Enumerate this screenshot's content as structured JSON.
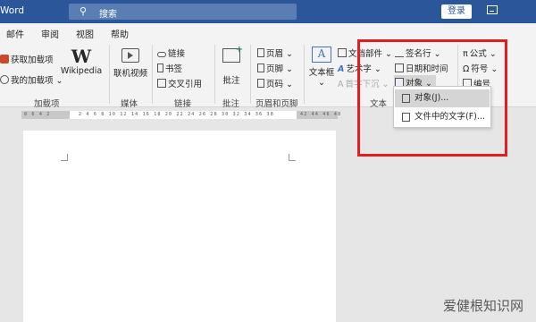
{
  "title_bar": {
    "app_name": "Word",
    "search_placeholder": "搜索",
    "login_label": "登录"
  },
  "tabs": [
    "邮件",
    "审阅",
    "视图",
    "帮助"
  ],
  "ribbon": {
    "addins": {
      "get": "获取加载项",
      "my": "我的加载项",
      "wiki": "Wikipedia",
      "label": "加载项"
    },
    "media": {
      "video": "联机视频",
      "label": "媒体"
    },
    "links": {
      "link": "链接",
      "bookmark": "书签",
      "crossref": "交叉引用",
      "label": "链接"
    },
    "comments": {
      "comment": "批注",
      "label": "批注"
    },
    "header_footer": {
      "header": "页眉",
      "footer": "页脚",
      "page_number": "页码",
      "label": "页眉和页脚"
    },
    "text": {
      "textbox": "文本框",
      "quickparts": "文档部件",
      "wordart": "艺术字",
      "dropcap": "首字下沉",
      "signature": "签名行",
      "datetime": "日期和时间",
      "object": "对象",
      "label": "文本"
    },
    "symbols": {
      "equation": "公式",
      "symbol": "符号",
      "numbering": "编号"
    }
  },
  "object_menu": {
    "items": [
      "对象(J)...",
      "文件中的文字(F)..."
    ]
  },
  "ruler": {
    "left_numbers": "8 6 4 2",
    "main_numbers": "2 4 6 8 10 12 14 16 18 20 22 24 26 28 30 32 34 36 38",
    "right_numbers": "42 44 46 48"
  },
  "watermark": "爱健根知识网",
  "colors": {
    "title_bar": "#2b579a",
    "ribbon_bg": "#f3f3f3",
    "highlight_box": "#e02020",
    "menu_hover": "#d5d5d5"
  }
}
